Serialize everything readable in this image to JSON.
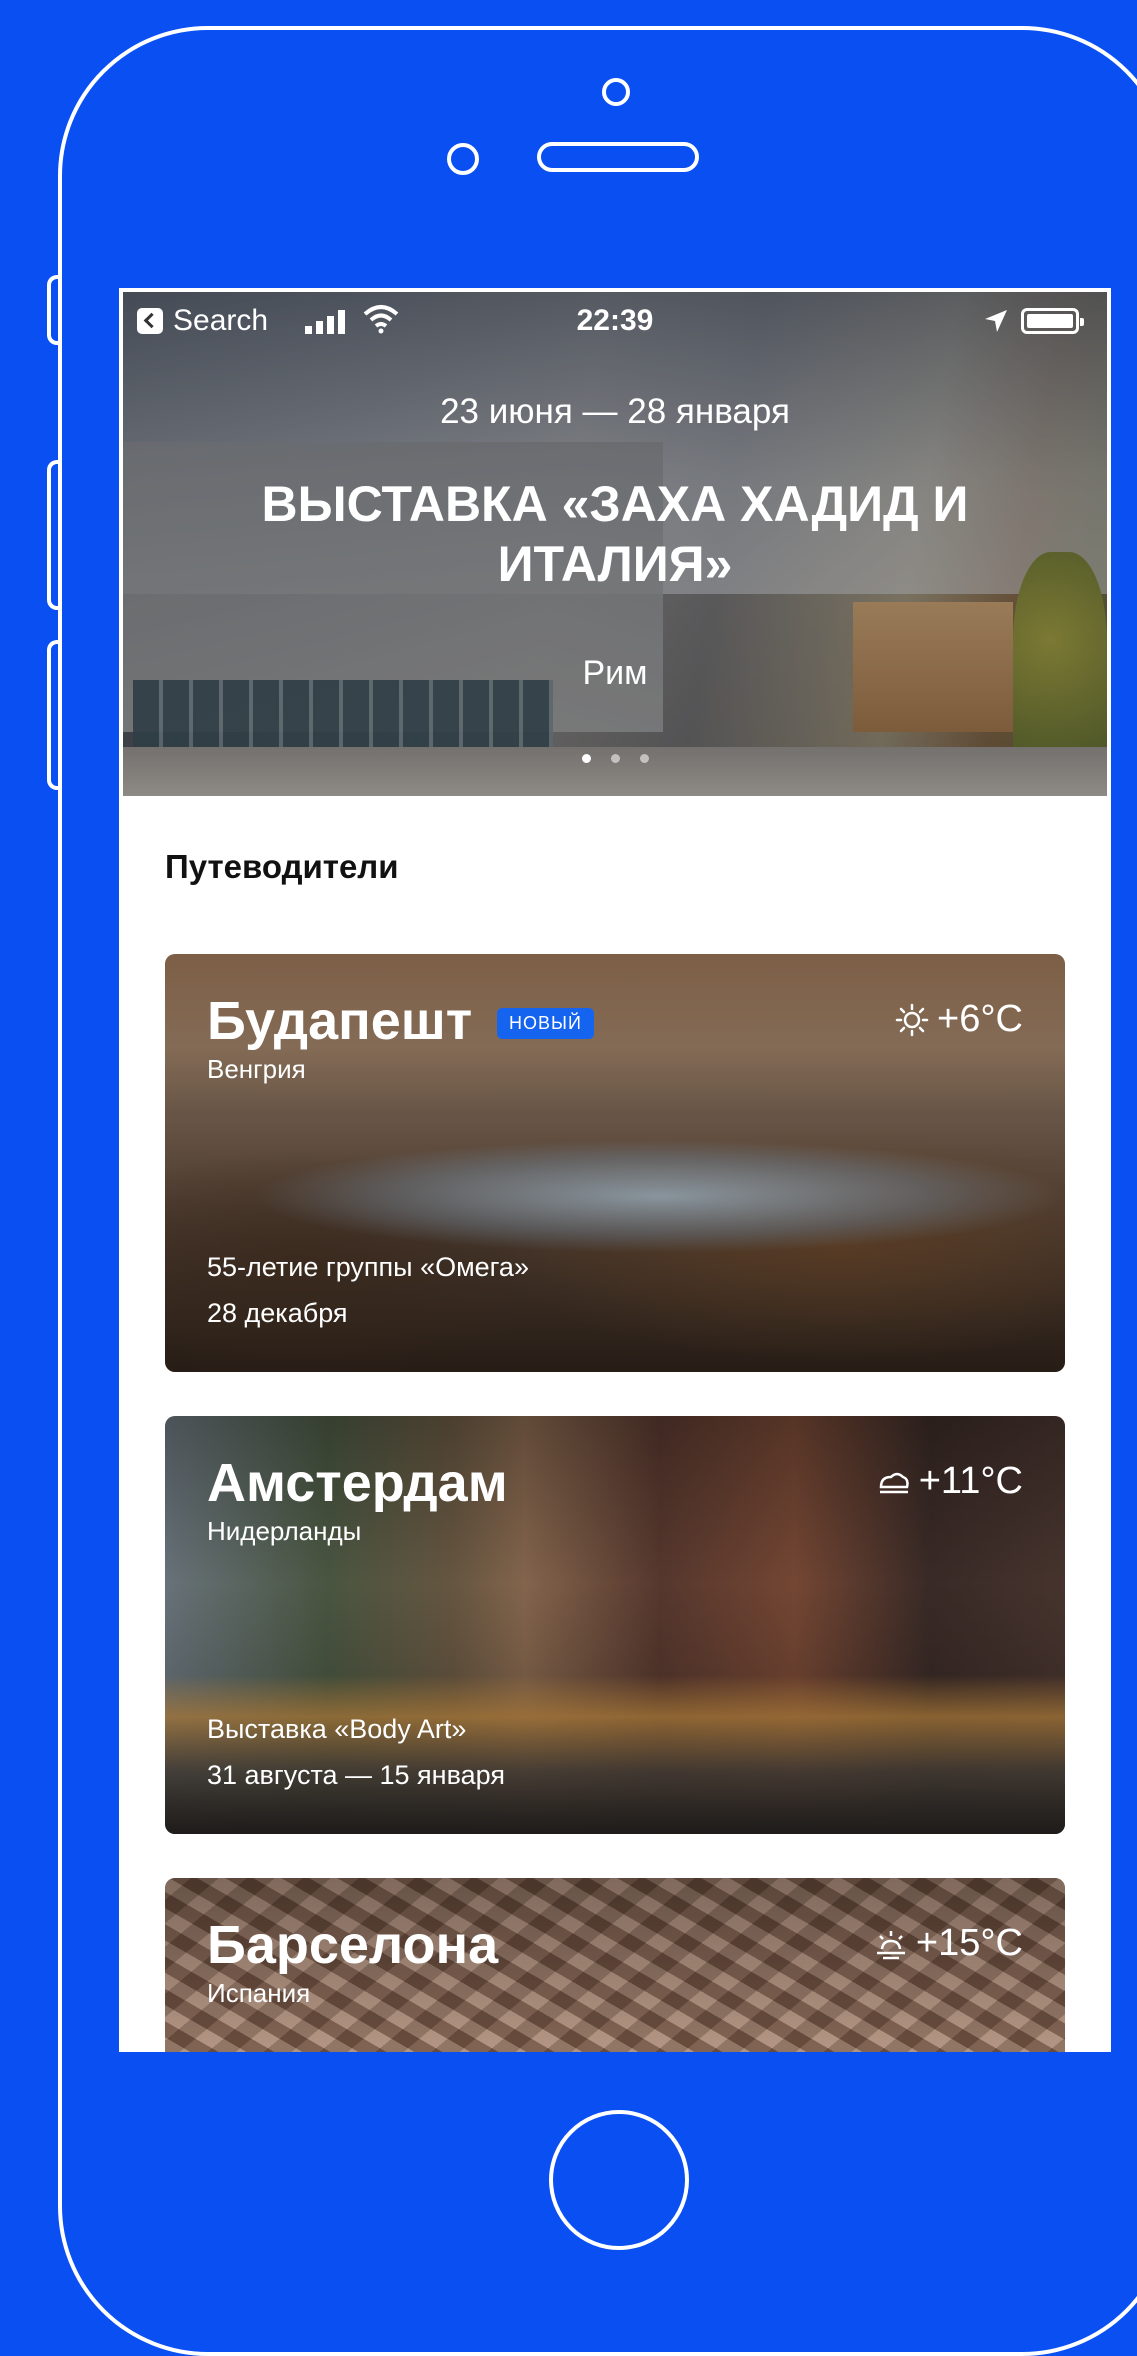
{
  "status_bar": {
    "back_label": "Search",
    "time": "22:39"
  },
  "hero": {
    "dates": "23 июня — 28 января",
    "title": "ВЫСТАВКА «ЗАХА ХАДИД И ИТАЛИЯ»",
    "city": "Рим",
    "pages_total": 3,
    "page_active": 1
  },
  "section": {
    "title": "Путеводители"
  },
  "cards": [
    {
      "city": "Будапешт",
      "country": "Венгрия",
      "badge": "НОВЫЙ",
      "weather_icon": "sun-icon",
      "temperature": "+6°C",
      "event": "55-летие группы «Омега»",
      "event_date": "28 декабря"
    },
    {
      "city": "Амстердам",
      "country": "Нидерланды",
      "weather_icon": "cloud-icon",
      "temperature": "+11°C",
      "event": "Выставка «Body Art»",
      "event_date": "31 августа — 15 января"
    },
    {
      "city": "Барселона",
      "country": "Испания",
      "weather_icon": "partly-cloudy-icon",
      "temperature": "+15°C"
    }
  ],
  "colors": {
    "background": "#0a4ff2",
    "badge": "#1464f0"
  }
}
